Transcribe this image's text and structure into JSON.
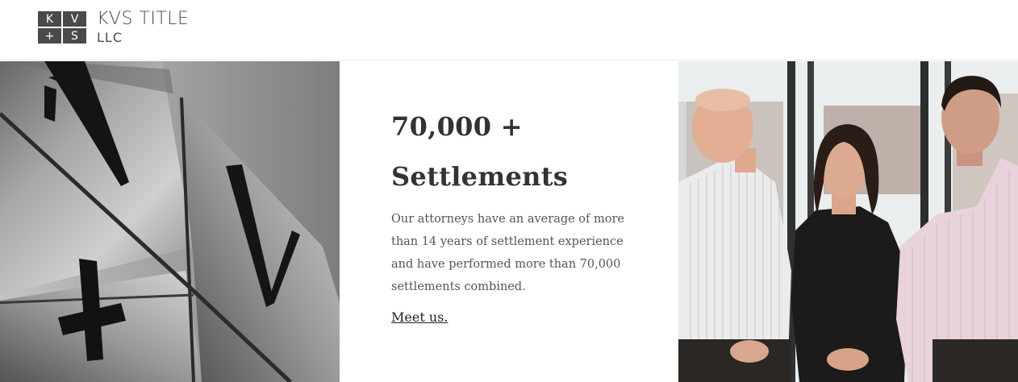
{
  "header": {
    "logo": {
      "mark": [
        "K",
        "V",
        "+",
        "S"
      ],
      "line1": "KVS TITLE",
      "line2": "LLC"
    }
  },
  "hero": {
    "headline_line1": "70,000 +",
    "headline_line2": "Settlements",
    "body": "Our attorneys have an average of more than 14 years of settlement experience and have performed more than 70,000 settlements combined.",
    "link_label": "Meet us."
  },
  "images": {
    "left": "brushed-metal-logo-letters-image",
    "right": "team-photo-three-attorneys"
  },
  "colors": {
    "logo_gray": "#4a4a4a",
    "text_dark": "#333333",
    "text_body": "#555555"
  }
}
